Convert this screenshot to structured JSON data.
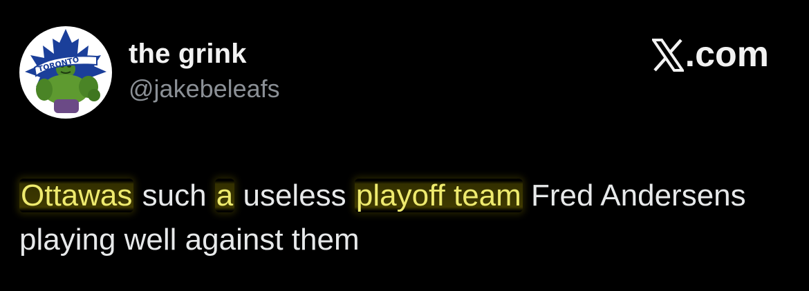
{
  "author": {
    "display_name": "the grink",
    "handle": "@jakebeleafs",
    "avatar": {
      "description_icon": "maple-leaf-hulk-avatar",
      "lettering": "TORONTO"
    }
  },
  "brand": {
    "logo_icon": "x-logo-icon",
    "label": ".com"
  },
  "tweet": {
    "segments": [
      {
        "text": "Ottawas",
        "highlighted": true
      },
      {
        "text": " such ",
        "highlighted": false
      },
      {
        "text": "a",
        "highlighted": true
      },
      {
        "text": " useless ",
        "highlighted": false
      },
      {
        "text": "playoff team",
        "highlighted": true
      },
      {
        "text": " Fred Andersens playing well against them",
        "highlighted": false
      }
    ]
  },
  "colors": {
    "background": "#000000",
    "text": "#e7e9ea",
    "handle": "#8b9096",
    "highlight_text": "#eeea6e",
    "leaf_blue": "#1b3f9a"
  }
}
